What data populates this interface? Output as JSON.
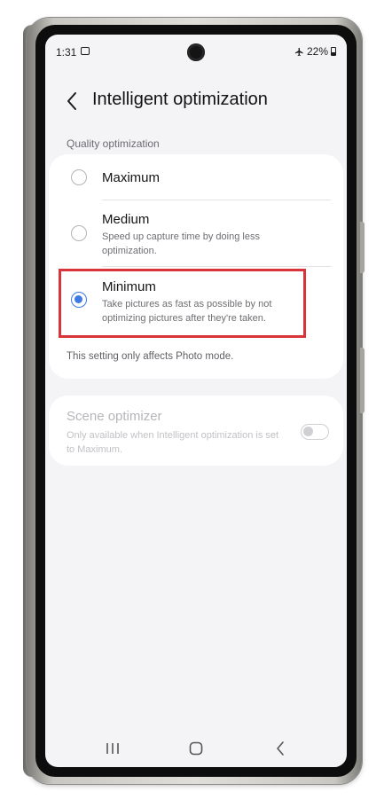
{
  "status_bar": {
    "time": "1:31",
    "battery_percent": "22%",
    "icons": [
      "gallery-notification-icon",
      "airplane-mode-icon",
      "battery-icon"
    ]
  },
  "header": {
    "title": "Intelligent optimization",
    "back_icon": "chevron-left-icon"
  },
  "quality": {
    "section_label": "Quality optimization",
    "options": [
      {
        "title": "Maximum",
        "description": "",
        "selected": false
      },
      {
        "title": "Medium",
        "description": "Speed up capture time by doing less optimization.",
        "selected": false
      },
      {
        "title": "Minimum",
        "description": "Take pictures as fast as possible by not optimizing pictures after they're taken.",
        "selected": true
      }
    ],
    "footnote": "This setting only affects Photo mode."
  },
  "scene_optimizer": {
    "title": "Scene optimizer",
    "description": "Only available when Intelligent optimization is set to Maximum.",
    "enabled": false,
    "toggle_on": false
  },
  "nav_bar": {
    "icons": [
      "recent-apps-icon",
      "home-icon",
      "back-icon"
    ]
  },
  "colors": {
    "accent": "#3e7ae6",
    "highlight": "#d8343a",
    "background": "#f4f4f6"
  }
}
